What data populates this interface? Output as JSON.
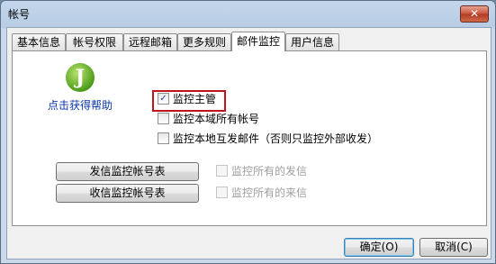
{
  "window": {
    "title": "帐号",
    "close_icon": "✕"
  },
  "tabs": [
    {
      "label": "基本信息",
      "active": false
    },
    {
      "label": "帐号权限",
      "active": false
    },
    {
      "label": "远程邮箱",
      "active": false
    },
    {
      "label": "更多规则",
      "active": false
    },
    {
      "label": "邮件监控",
      "active": true
    },
    {
      "label": "用户信息",
      "active": false
    }
  ],
  "help": {
    "icon": "help-logo-icon",
    "glyph": "J",
    "label": "点击获得帮助"
  },
  "options": {
    "monitor_supervisor": {
      "label": "监控主管",
      "checked": true,
      "mark": "✓"
    },
    "monitor_domain_accounts": {
      "label": "监控本域所有帐号",
      "checked": false
    },
    "monitor_local_mutual": {
      "label": "监控本地互发邮件（否则只监控外部收发）",
      "checked": false
    },
    "monitor_all_sent": {
      "label": "监控所有的发信",
      "checked": false,
      "disabled": true
    },
    "monitor_all_received": {
      "label": "监控所有的来信",
      "checked": false,
      "disabled": true
    }
  },
  "buttons": {
    "send_list": "发信监控帐号表",
    "receive_list": "收信监控帐号表",
    "ok": "确定(O)",
    "cancel": "取消(C)"
  },
  "colors": {
    "highlight": "#c0141a",
    "link": "#0b37a8",
    "title_close": "#c7513a"
  }
}
